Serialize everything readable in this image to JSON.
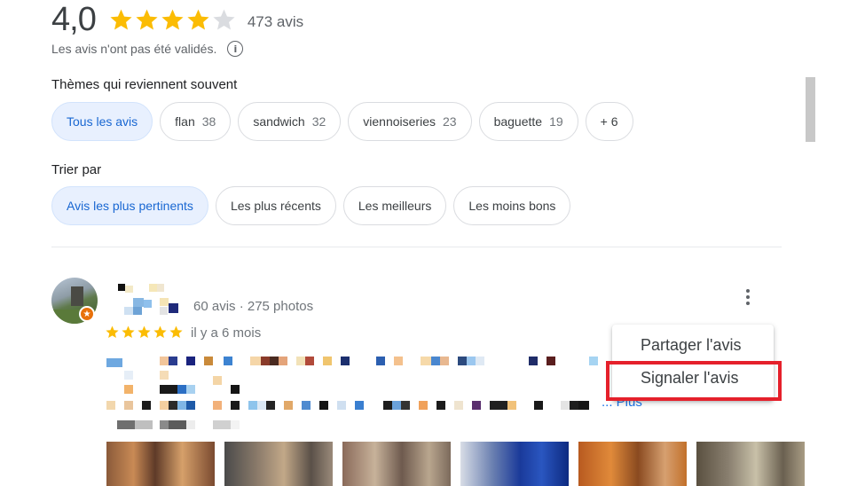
{
  "rating": {
    "score": "4,0",
    "stars_filled": 4,
    "stars_total": 5,
    "review_count": "473 avis",
    "not_validated": "Les avis n'ont pas été validés.",
    "info_icon": "info-icon"
  },
  "topics": {
    "title": "Thèmes qui reviennent souvent",
    "chips": [
      {
        "label": "Tous les avis",
        "count": ""
      },
      {
        "label": "flan",
        "count": "38"
      },
      {
        "label": "sandwich",
        "count": "32"
      },
      {
        "label": "viennoiseries",
        "count": "23"
      },
      {
        "label": "baguette",
        "count": "19"
      },
      {
        "label": "+ 6",
        "count": ""
      }
    ]
  },
  "sort": {
    "title": "Trier par",
    "options": [
      {
        "label": "Avis les plus pertinents"
      },
      {
        "label": "Les plus récents"
      },
      {
        "label": "Les meilleurs"
      },
      {
        "label": "Les moins bons"
      }
    ]
  },
  "review": {
    "reviewer_meta": "60 avis · 275 photos",
    "stars": 5,
    "date": "il y a 6 mois",
    "more_link": "... Plus",
    "overflow_icon": "more-vert-icon",
    "photo_count": 6
  },
  "menu": {
    "share": "Partager l'avis",
    "report": "Signaler l'avis"
  },
  "colors": {
    "star_gold": "#fbbc04",
    "star_empty": "#dadce0",
    "chip_active_bg": "#e8f0fe",
    "chip_active_text": "#1967d2",
    "highlight_red": "#e5202b",
    "link_blue": "#1a73e8"
  }
}
